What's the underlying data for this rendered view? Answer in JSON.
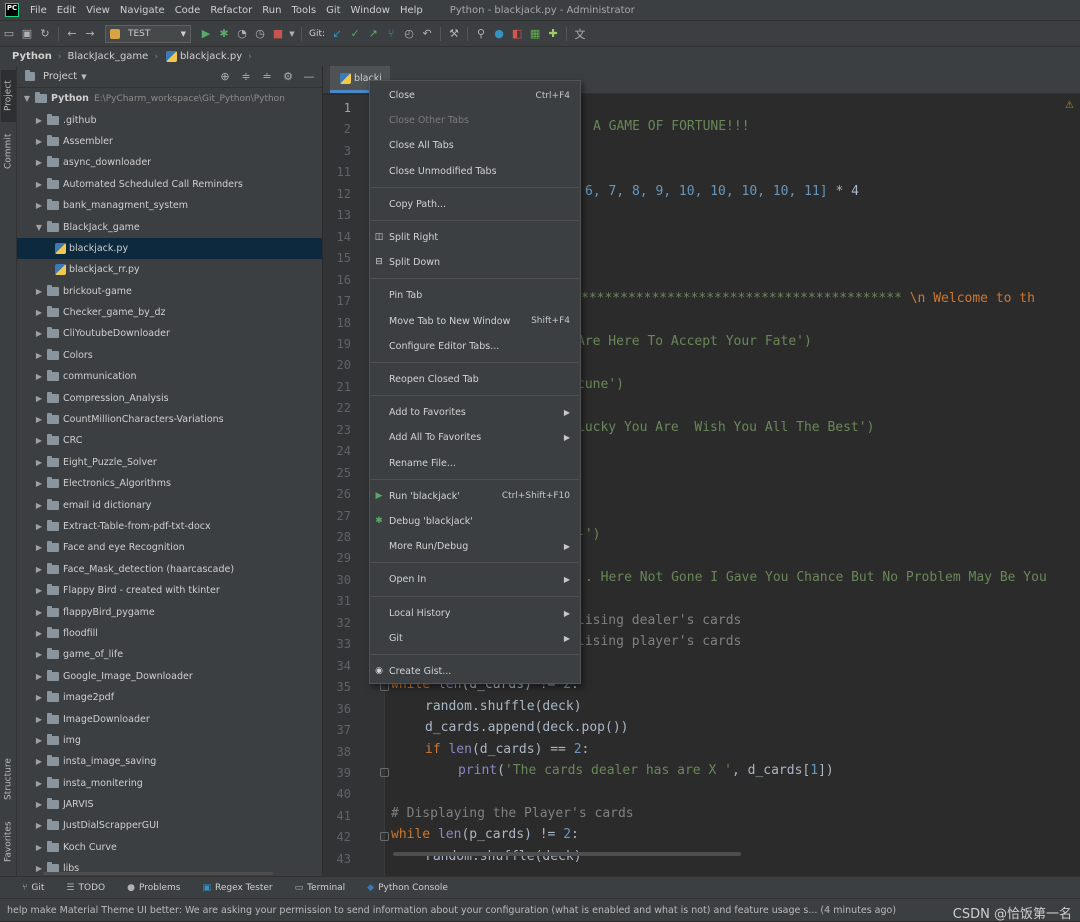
{
  "menubar": {
    "logo": "PC",
    "items": [
      "File",
      "Edit",
      "View",
      "Navigate",
      "Code",
      "Refactor",
      "Run",
      "Tools",
      "Git",
      "Window",
      "Help"
    ],
    "window_title": "Python - blackjack.py - Administrator"
  },
  "toolbar": {
    "run_config": "TEST",
    "git_label": "Git:"
  },
  "breadcrumbs": [
    "Python",
    "BlackJack_game",
    "blackjack.py"
  ],
  "side_tabs": {
    "project": "Project",
    "commit": "Commit",
    "structure": "Structure",
    "favorites": "Favorites"
  },
  "project": {
    "header": "Project",
    "root_name": "Python",
    "root_path": "E:\\PyCharm_workspace\\Git_Python\\Python",
    "items": [
      {
        "label": ".github",
        "type": "folder",
        "depth": 1
      },
      {
        "label": "Assembler",
        "type": "folder",
        "depth": 1
      },
      {
        "label": "async_downloader",
        "type": "folder",
        "depth": 1
      },
      {
        "label": "Automated Scheduled Call Reminders",
        "type": "folder",
        "depth": 1
      },
      {
        "label": "bank_managment_system",
        "type": "folder",
        "depth": 1
      },
      {
        "label": "BlackJack_game",
        "type": "folder",
        "depth": 1,
        "open": true
      },
      {
        "label": "blackjack.py",
        "type": "py",
        "depth": 2,
        "selected": true
      },
      {
        "label": "blackjack_rr.py",
        "type": "py",
        "depth": 2
      },
      {
        "label": "brickout-game",
        "type": "folder",
        "depth": 1
      },
      {
        "label": "Checker_game_by_dz",
        "type": "folder",
        "depth": 1
      },
      {
        "label": "CliYoutubeDownloader",
        "type": "folder",
        "depth": 1
      },
      {
        "label": "Colors",
        "type": "folder",
        "depth": 1
      },
      {
        "label": "communication",
        "type": "folder",
        "depth": 1
      },
      {
        "label": "Compression_Analysis",
        "type": "folder",
        "depth": 1
      },
      {
        "label": "CountMillionCharacters-Variations",
        "type": "folder",
        "depth": 1
      },
      {
        "label": "CRC",
        "type": "folder",
        "depth": 1
      },
      {
        "label": "Eight_Puzzle_Solver",
        "type": "folder",
        "depth": 1
      },
      {
        "label": "Electronics_Algorithms",
        "type": "folder",
        "depth": 1
      },
      {
        "label": "email id dictionary",
        "type": "folder",
        "depth": 1
      },
      {
        "label": "Extract-Table-from-pdf-txt-docx",
        "type": "folder",
        "depth": 1
      },
      {
        "label": "Face and eye Recognition",
        "type": "folder",
        "depth": 1
      },
      {
        "label": "Face_Mask_detection (haarcascade)",
        "type": "folder",
        "depth": 1
      },
      {
        "label": "Flappy Bird - created with tkinter",
        "type": "folder",
        "depth": 1
      },
      {
        "label": "flappyBird_pygame",
        "type": "folder",
        "depth": 1
      },
      {
        "label": "floodfill",
        "type": "folder",
        "depth": 1
      },
      {
        "label": "game_of_life",
        "type": "folder",
        "depth": 1
      },
      {
        "label": "Google_Image_Downloader",
        "type": "folder",
        "depth": 1
      },
      {
        "label": "image2pdf",
        "type": "folder",
        "depth": 1
      },
      {
        "label": "ImageDownloader",
        "type": "folder",
        "depth": 1
      },
      {
        "label": "img",
        "type": "folder",
        "depth": 1
      },
      {
        "label": "insta_image_saving",
        "type": "folder",
        "depth": 1
      },
      {
        "label": "insta_monitering",
        "type": "folder",
        "depth": 1
      },
      {
        "label": "JARVIS",
        "type": "folder",
        "depth": 1
      },
      {
        "label": "JustDialScrapperGUI",
        "type": "folder",
        "depth": 1
      },
      {
        "label": "Koch Curve",
        "type": "folder",
        "depth": 1
      },
      {
        "label": "libs",
        "type": "folder",
        "depth": 1
      }
    ]
  },
  "editor": {
    "tab_label": "blackj",
    "line_numbers": [
      "1",
      "2",
      "3",
      "11",
      "12",
      "13",
      "14",
      "15",
      "16",
      "17",
      "18",
      "19",
      "20",
      "21",
      "22",
      "23",
      "24",
      "25",
      "26",
      "27",
      "28",
      "29",
      "30",
      "31",
      "32",
      "33",
      "34",
      "35",
      "36",
      "37",
      "38",
      "39",
      "40",
      "41",
      "42",
      "43"
    ],
    "code_fragments": {
      "l2": "A GAME OF FORTUNE!!!",
      "l12a": "6, 7, 8, 9, 10, 10, 10, 10, 11]",
      "l12b": " * 4",
      "l17a": "*****************************************",
      "l17b": " \\n Welcome to th",
      "l19": "Are Here To Accept Your Fate')",
      "l21": "tune')",
      "l23": "Lucky You Are  Wish You All The Best')",
      "l28": "-')",
      "l30": ". Here Not Gone I Gave You Chance But No Problem May Be You",
      "l32": "lising dealer's cards",
      "l33": "lising player's cards",
      "l35_kw": "while",
      "l35_fn": "len",
      "l35_rest": "(d_cards) != ",
      "l35_num": "2",
      "l35_end": ":",
      "l36": "random.shuffle(deck)",
      "l37": "d_cards.append(deck.pop())",
      "l38_kw": "if",
      "l38_fn": "len",
      "l38_rest": "(d_cards) == ",
      "l38_num": "2",
      "l38_end": ":",
      "l39_fn": "print",
      "l39_str": "'The cards dealer has are X '",
      "l39_rest": ", d_cards[",
      "l39_num": "1",
      "l39_end": "])",
      "l41": "# Displaying the Player's cards",
      "l42_kw": "while",
      "l42_fn": "len",
      "l42_rest": "(p_cards) != ",
      "l42_num": "2",
      "l42_end": ":",
      "l43": "random.shuffle(deck)"
    }
  },
  "context_menu": [
    {
      "label": "Close",
      "shortcut": "Ctrl+F4",
      "hover": false
    },
    {
      "label": "Close Other Tabs",
      "disabled": true
    },
    {
      "label": "Close All Tabs"
    },
    {
      "label": "Close Unmodified Tabs"
    },
    {
      "sep": true
    },
    {
      "label": "Copy Path..."
    },
    {
      "sep": true
    },
    {
      "label": "Split Right",
      "lead": "split-right-icon"
    },
    {
      "label": "Split Down",
      "lead": "split-down-icon"
    },
    {
      "sep": true
    },
    {
      "label": "Pin Tab"
    },
    {
      "label": "Move Tab to New Window",
      "shortcut": "Shift+F4"
    },
    {
      "label": "Configure Editor Tabs..."
    },
    {
      "sep": true
    },
    {
      "label": "Reopen Closed Tab"
    },
    {
      "sep": true
    },
    {
      "label": "Add to Favorites",
      "submenu": true
    },
    {
      "label": "Add All To Favorites",
      "submenu": true
    },
    {
      "label": "Rename File..."
    },
    {
      "sep": true
    },
    {
      "label": "Run 'blackjack'",
      "shortcut": "Ctrl+Shift+F10",
      "lead": "run-icon"
    },
    {
      "label": "Debug 'blackjack'",
      "lead": "debug-icon"
    },
    {
      "label": "More Run/Debug",
      "submenu": true
    },
    {
      "sep": true
    },
    {
      "label": "Open In",
      "submenu": true
    },
    {
      "sep": true
    },
    {
      "label": "Local History",
      "submenu": true
    },
    {
      "label": "Git",
      "submenu": true
    },
    {
      "sep": true
    },
    {
      "label": "Create Gist...",
      "lead": "github-icon"
    }
  ],
  "bottom_tools": [
    {
      "label": "Git",
      "icon": "git-branch-icon"
    },
    {
      "label": "TODO",
      "icon": "list-icon"
    },
    {
      "label": "Problems",
      "icon": "problems-icon"
    },
    {
      "label": "Regex Tester",
      "icon": "regex-icon"
    },
    {
      "label": "Terminal",
      "icon": "terminal-icon"
    },
    {
      "label": "Python Console",
      "icon": "python-icon"
    }
  ],
  "status": {
    "message": "help make Material Theme UI better: We are asking your permission to send information about your configuration (what is enabled and what is not) and feature usage s... (4 minutes ago)",
    "watermark": "CSDN @恰饭第一名"
  },
  "colors": {
    "accent": "#4b6eaf",
    "selection": "#0d293e",
    "keyword": "#cc7832",
    "string": "#6a8759",
    "number": "#6897bb"
  }
}
